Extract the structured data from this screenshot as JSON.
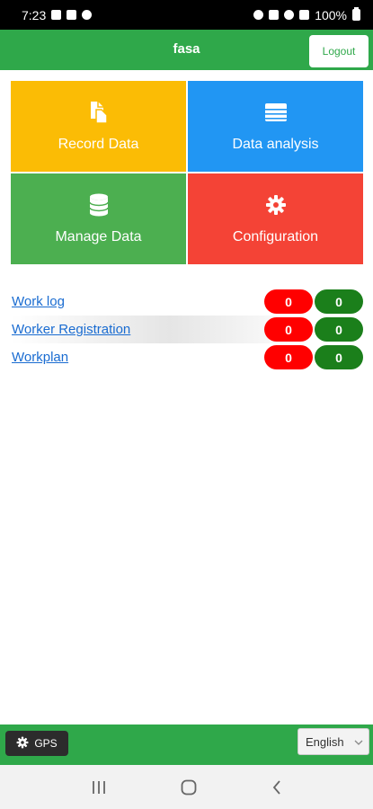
{
  "status_bar": {
    "time": "7:23",
    "battery": "100%"
  },
  "header": {
    "title": "fasa",
    "logout_label": "Logout"
  },
  "tiles": [
    {
      "label": "Record Data",
      "icon": "file-icon",
      "color": "#fbbc05"
    },
    {
      "label": "Data analysis",
      "icon": "list-icon",
      "color": "#2196f3"
    },
    {
      "label": "Manage Data",
      "icon": "database-icon",
      "color": "#4caf50"
    },
    {
      "label": "Configuration",
      "icon": "gear-icon",
      "color": "#f44336"
    }
  ],
  "lists": [
    {
      "label": "Work log",
      "red_count": "0",
      "green_count": "0"
    },
    {
      "label": "Worker Registration",
      "red_count": "0",
      "green_count": "0"
    },
    {
      "label": "Workplan",
      "red_count": "0",
      "green_count": "0"
    }
  ],
  "footer": {
    "gps_label": "GPS",
    "language": "English"
  }
}
